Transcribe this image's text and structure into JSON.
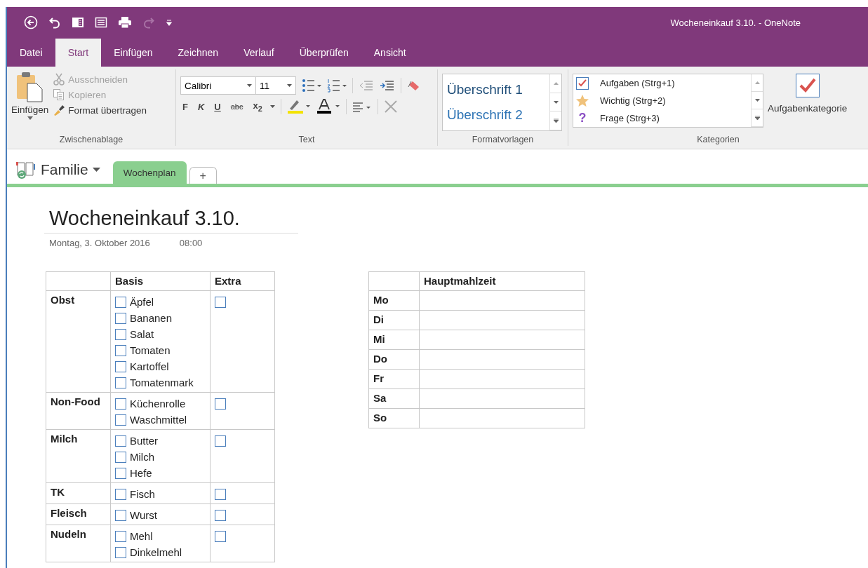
{
  "window": {
    "title": "Wocheneinkauf 3.10.  -  OneNote"
  },
  "menu_tabs": [
    {
      "label": "Datei",
      "selected": false
    },
    {
      "label": "Start",
      "selected": true
    },
    {
      "label": "Einfügen",
      "selected": false
    },
    {
      "label": "Zeichnen",
      "selected": false
    },
    {
      "label": "Verlauf",
      "selected": false
    },
    {
      "label": "Überprüfen",
      "selected": false
    },
    {
      "label": "Ansicht",
      "selected": false
    }
  ],
  "clipboard": {
    "paste": "Einfügen",
    "items": [
      {
        "label": "Ausschneiden",
        "disabled": true,
        "kind": "cut"
      },
      {
        "label": "Kopieren",
        "disabled": true,
        "kind": "copy"
      },
      {
        "label": "Format übertragen",
        "disabled": false,
        "kind": "brush"
      }
    ],
    "group": "Zwischenablage"
  },
  "text": {
    "font": "Calibri",
    "size": "11",
    "formats": [
      {
        "label": "F",
        "kind": "bold"
      },
      {
        "label": "K",
        "kind": "italic"
      },
      {
        "label": "U",
        "kind": "underline"
      },
      {
        "label": "abc",
        "kind": "strike"
      },
      {
        "label": "x$_{2}$",
        "kind": "sub"
      }
    ],
    "group": "Text"
  },
  "styles": {
    "items": [
      "Überschrift 1",
      "Überschrift 2"
    ],
    "group": "Formatvorlagen"
  },
  "tags": {
    "items": [
      {
        "label": "Aufgaben (Strg+1)",
        "kind": "checkbox"
      },
      {
        "label": "Wichtig (Strg+2)",
        "kind": "star"
      },
      {
        "label": "Frage (Strg+3)",
        "kind": "question",
        "symbol": "?"
      }
    ],
    "button": "Aufgabenkategorie",
    "group": "Kategorien"
  },
  "notebook": {
    "name": "Familie",
    "sections": [
      {
        "label": "Wochenplan",
        "selected": true
      }
    ],
    "add": "+"
  },
  "page": {
    "title": "Wocheneinkauf 3.10.",
    "date": "Montag, 3. Oktober 2016",
    "time": "08:00"
  },
  "shopping": {
    "columns": [
      "Basis",
      "Extra"
    ],
    "rows": [
      {
        "category": "Obst",
        "items": [
          {
            "label": "Äpfel",
            "checked": false
          },
          {
            "label": "Bananen",
            "checked": false
          },
          {
            "label": "Salat",
            "checked": false
          },
          {
            "label": "Tomaten",
            "checked": false
          },
          {
            "label": "Kartoffel",
            "checked": false
          },
          {
            "label": "Tomatenmark",
            "checked": false
          }
        ],
        "extra_checked": false
      },
      {
        "category": "Non-Food",
        "items": [
          {
            "label": "Küchenrolle",
            "checked": false
          },
          {
            "label": "Waschmittel",
            "checked": false
          }
        ],
        "extra_checked": false
      },
      {
        "category": "Milch",
        "items": [
          {
            "label": "Butter",
            "checked": false
          },
          {
            "label": "Milch",
            "checked": false
          },
          {
            "label": "Hefe",
            "checked": false
          }
        ],
        "extra_checked": false
      },
      {
        "category": "TK",
        "items": [
          {
            "label": "Fisch",
            "checked": false
          }
        ],
        "extra_checked": false
      },
      {
        "category": "Fleisch",
        "items": [
          {
            "label": "Wurst",
            "checked": false
          }
        ],
        "extra_checked": false
      },
      {
        "category": "Nudeln",
        "items": [
          {
            "label": "Mehl",
            "checked": false
          },
          {
            "label": "Dinkelmehl",
            "checked": false
          }
        ],
        "extra_checked": false
      }
    ]
  },
  "meals": {
    "column": "Hauptmahlzeit",
    "rows": [
      "Mo",
      "Di",
      "Mi",
      "Do",
      "Fr",
      "Sa",
      "So"
    ]
  }
}
